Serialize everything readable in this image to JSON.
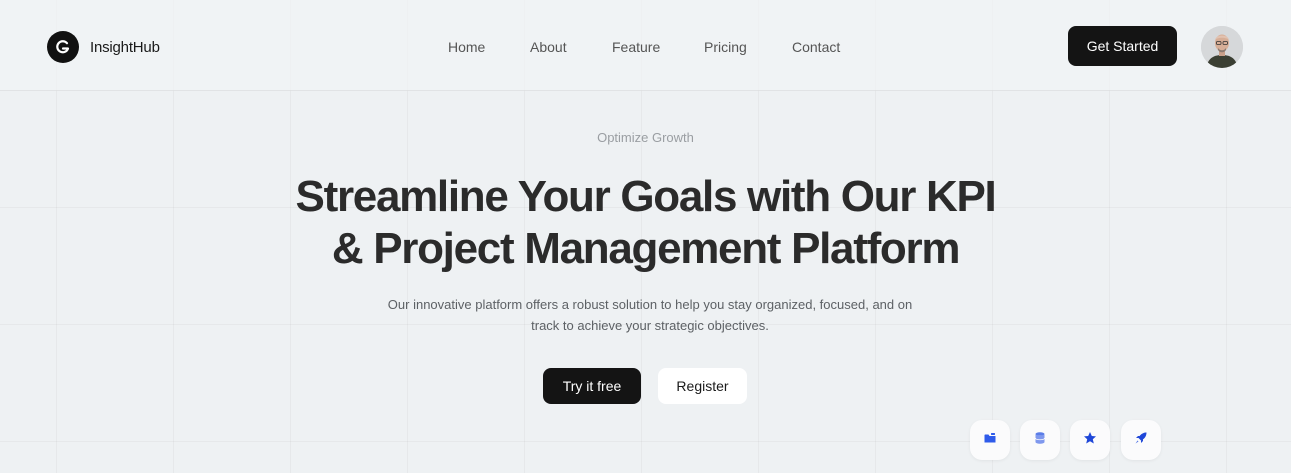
{
  "brand": {
    "name": "InsightHub",
    "logo_icon": "insighthub-logo-icon"
  },
  "nav": {
    "items": [
      {
        "label": "Home"
      },
      {
        "label": "About"
      },
      {
        "label": "Feature"
      },
      {
        "label": "Pricing"
      },
      {
        "label": "Contact"
      }
    ]
  },
  "header": {
    "cta_label": "Get Started",
    "avatar_icon": "user-avatar"
  },
  "hero": {
    "eyebrow": "Optimize Growth",
    "headline_line1": "Streamline Your Goals with Our KPI",
    "headline_line2": "& Project Management Platform",
    "subtitle_line1": "Our innovative platform offers a robust solution to help you stay organized, focused, and on",
    "subtitle_line2": "track to achieve your strategic objectives.",
    "primary_label": "Try it free",
    "secondary_label": "Register"
  },
  "feature_icons": [
    "folder-icon",
    "database-icon",
    "star-icon",
    "rocket-icon"
  ],
  "colors": {
    "accent_blue": "#2f5bea",
    "button_dark": "#141414",
    "background": "#eef1f3"
  }
}
